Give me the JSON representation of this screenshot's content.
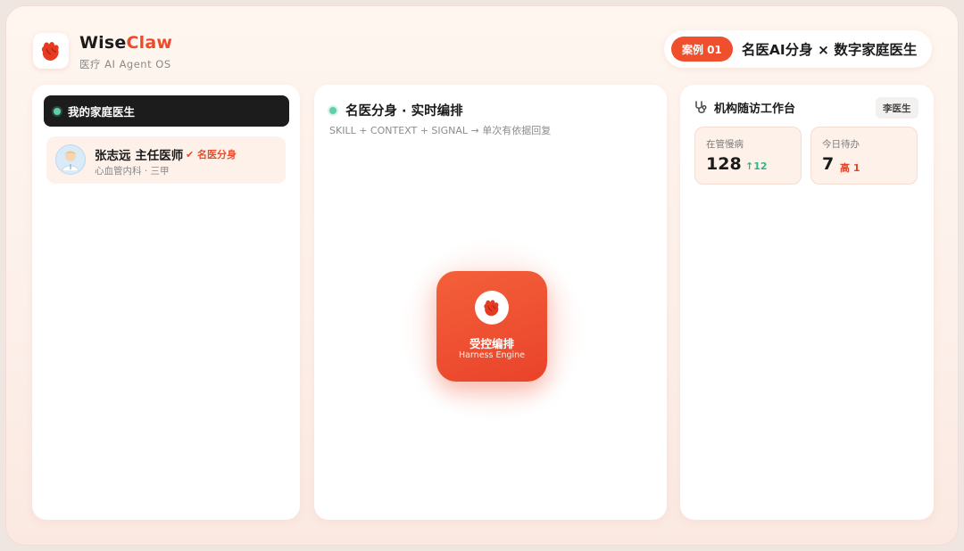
{
  "brand": {
    "name_part1": "Wise",
    "name_part2": "Claw",
    "subtitle": "医疗 AI Agent OS",
    "logo_icon": "claw-icon"
  },
  "case": {
    "badge": "案例 01",
    "title": "名医AI分身 × 数字家庭医生"
  },
  "left_panel": {
    "header": "我的家庭医生",
    "doctor": {
      "avatar_icon": "doctor-avatar-icon",
      "name": "张志远 主任医师",
      "badge": "✔ 名医分身",
      "department": "心血管内科 · 三甲"
    }
  },
  "middle_panel": {
    "title": "名医分身 · 实时编排",
    "subtitle": "SKILL + CONTEXT + SIGNAL → 单次有依据回复",
    "engine": {
      "label": "受控编排",
      "sublabel": "Harness Engine",
      "icon": "claw-icon"
    }
  },
  "right_panel": {
    "title": "机构随访工作台",
    "title_icon": "stethoscope-icon",
    "doctor_chip": "李医生",
    "stats": [
      {
        "label": "在管慢病",
        "value": "128",
        "delta": "↑12"
      },
      {
        "label": "今日待办",
        "value": "7",
        "delta": "高 1"
      }
    ]
  },
  "colors": {
    "accent": "#ee4a2a",
    "status_dot": "#5ecfa6",
    "positive": "#2fb58b"
  }
}
